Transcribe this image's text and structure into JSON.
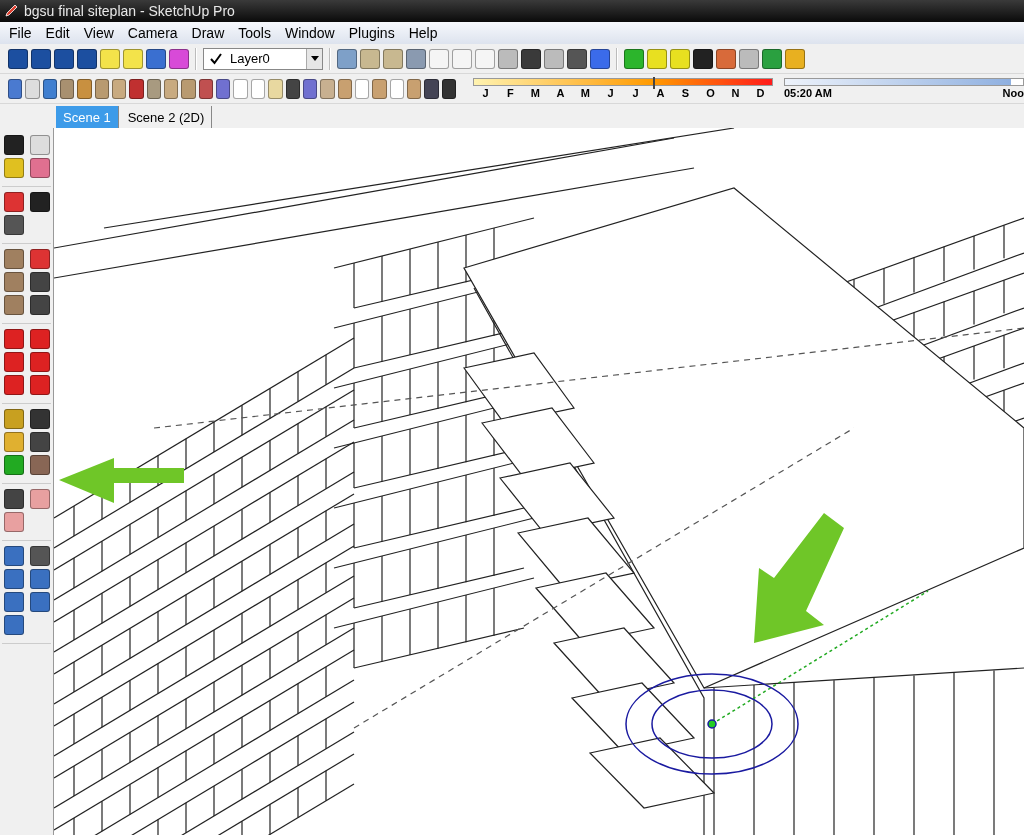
{
  "window": {
    "title": "bgsu final siteplan - SketchUp Pro"
  },
  "menu": [
    "File",
    "Edit",
    "View",
    "Camera",
    "Draw",
    "Tools",
    "Window",
    "Plugins",
    "Help"
  ],
  "layer_dropdown": {
    "value": "Layer0"
  },
  "shadow_settings": {
    "months": [
      "J",
      "F",
      "M",
      "A",
      "M",
      "J",
      "J",
      "A",
      "S",
      "O",
      "N",
      "D"
    ],
    "month_slider": {
      "level": 0.6
    },
    "time_slider": {
      "level": 0.95
    },
    "time": "05:20 AM",
    "time_end": "Noo"
  },
  "scene_tabs": [
    {
      "label": "Scene 1",
      "selected": true
    },
    {
      "label": "Scene 2 (2D)",
      "selected": false
    }
  ]
}
